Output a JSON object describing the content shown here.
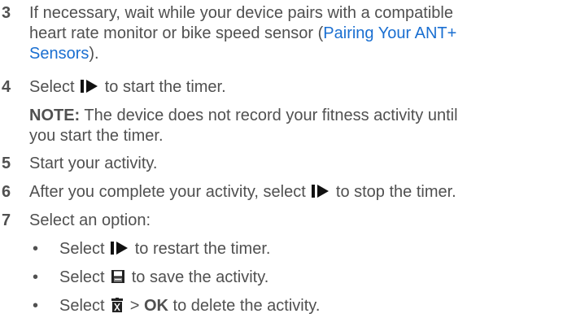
{
  "steps": [
    {
      "num": "3",
      "line1": "If necessary, wait while your device pairs with a compatible",
      "line2": "heart rate monitor or bike speed sensor (",
      "link_part1": "Pairing Your ANT+",
      "link_part2": "Sensors",
      "line3_tail": ")."
    },
    {
      "num": "4",
      "before": "Select",
      "after": "to start the timer."
    },
    {
      "note_label": "NOTE:",
      "note_line1": "The device does not record your fitness activity until",
      "note_line2": "you start the timer."
    },
    {
      "num": "5",
      "text": "Start your activity."
    },
    {
      "num": "6",
      "before": "After you complete your activity, select",
      "after": "to stop the timer."
    },
    {
      "num": "7",
      "text": "Select an option:"
    }
  ],
  "options": [
    {
      "bullet": "•",
      "before": "Select",
      "after": "to restart the timer.",
      "icon": "start-stop-icon"
    },
    {
      "bullet": "•",
      "before": "Select",
      "after": "to save the activity.",
      "icon": "save-icon"
    },
    {
      "bullet": "•",
      "before": "Select",
      "middle": ">",
      "bold": "OK",
      "after": "to delete the activity.",
      "icon": "trash-icon"
    }
  ],
  "colors": {
    "text": "#505050",
    "link": "#1a6fd1"
  }
}
